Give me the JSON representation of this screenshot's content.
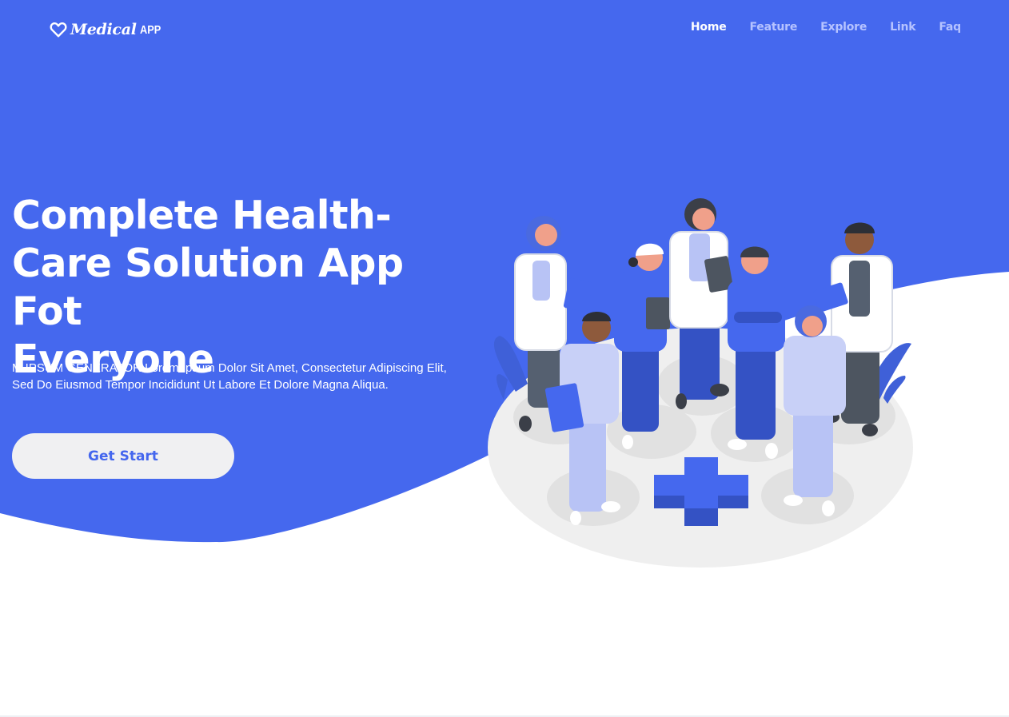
{
  "brand": {
    "name": "Medical",
    "suffix": "APP",
    "icon": "heart-icon"
  },
  "nav": {
    "items": [
      {
        "label": "Home",
        "active": true
      },
      {
        "label": "Feature",
        "active": false
      },
      {
        "label": "Explore",
        "active": false
      },
      {
        "label": "Link",
        "active": false
      },
      {
        "label": "Faq",
        "active": false
      }
    ]
  },
  "hero": {
    "headline_line1": "Complete Health-",
    "headline_line2": "Care Solution App Fot",
    "headline_line3": "Everyone",
    "subtext_line1": "M IPSUM GENERATOR Lorem Ipsum Dolor Sit Amet, Consectetur Adipiscing Elit,",
    "subtext_line2": "Sed Do Eiusmod Tempor Incididunt Ut Labore Et Dolore Magna Aliqua.",
    "cta_label": "Get Start"
  },
  "colors": {
    "primary": "#4568ee",
    "white": "#ffffff",
    "nav_inactive": "#b6c3ff",
    "button_bg": "#f0f0f2",
    "button_text": "#4466ee",
    "platform": "#efefef",
    "shadow": "#e1e1e1"
  },
  "illustration": {
    "icon": "medical-team-illustration"
  }
}
